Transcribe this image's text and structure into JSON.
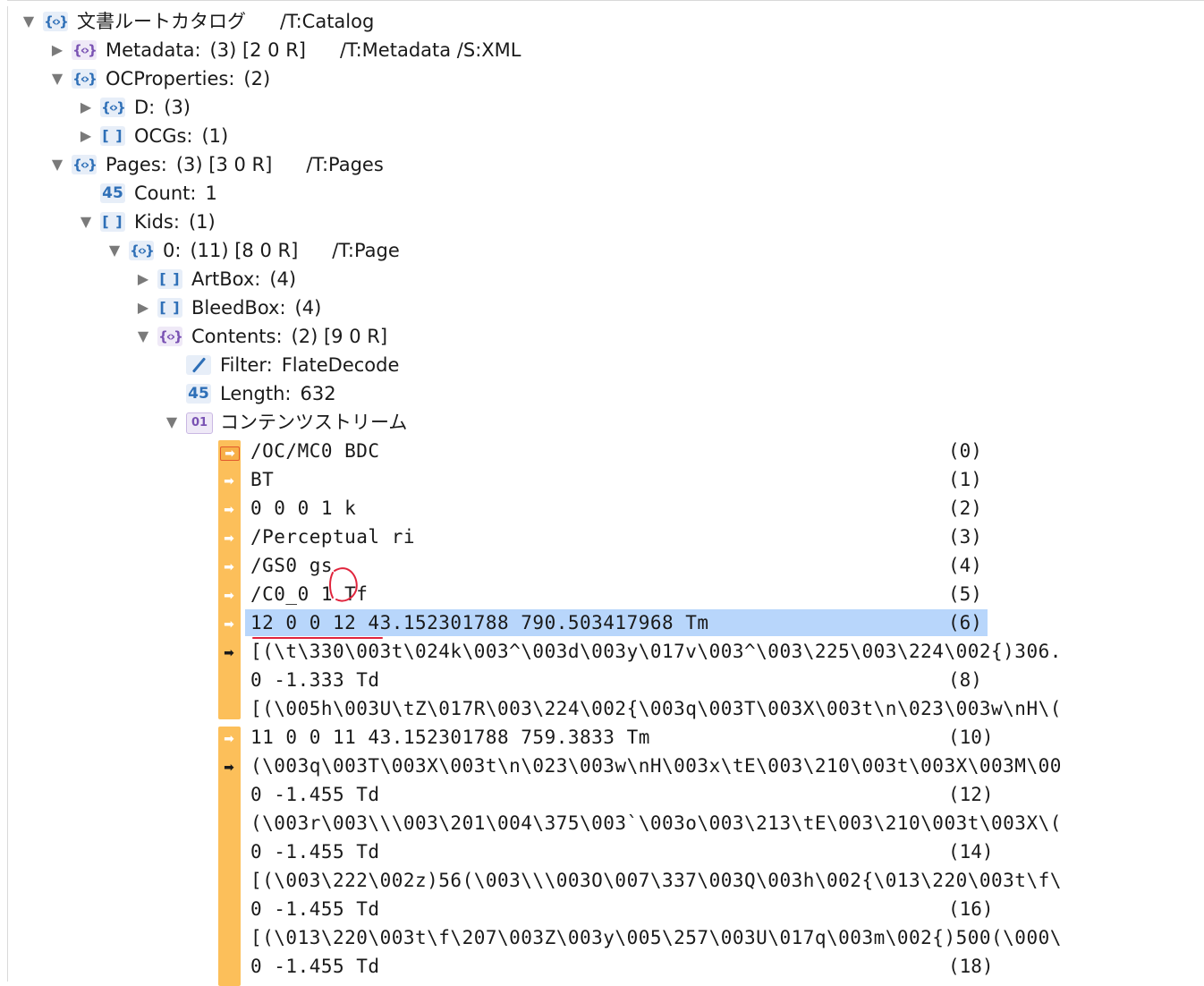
{
  "tree": [
    {
      "indent": 0,
      "toggle": "down",
      "icon": "dict",
      "label": "文書ルートカタログ",
      "info": "",
      "type": "/T:Catalog"
    },
    {
      "indent": 1,
      "toggle": "right",
      "icon": "dict-purple",
      "label": "Metadata:",
      "info": "(3) [2 0 R]",
      "type": "/T:Metadata  /S:XML"
    },
    {
      "indent": 1,
      "toggle": "down",
      "icon": "dict",
      "label": "OCProperties:",
      "info": "(2)",
      "type": ""
    },
    {
      "indent": 2,
      "toggle": "right",
      "icon": "dict",
      "label": "D:",
      "info": "(3)",
      "type": ""
    },
    {
      "indent": 2,
      "toggle": "right",
      "icon": "array",
      "label": "OCGs:",
      "info": "(1)",
      "type": ""
    },
    {
      "indent": 1,
      "toggle": "down",
      "icon": "dict",
      "label": "Pages:",
      "info": "(3) [3 0 R]",
      "type": "/T:Pages"
    },
    {
      "indent": 2,
      "toggle": "",
      "icon": "number",
      "label": "Count:",
      "info": "1",
      "type": ""
    },
    {
      "indent": 2,
      "toggle": "down",
      "icon": "array",
      "label": "Kids:",
      "info": "(1)",
      "type": ""
    },
    {
      "indent": 3,
      "toggle": "down",
      "icon": "dict",
      "label": "0:",
      "info": "(11) [8 0 R]",
      "type": "/T:Page"
    },
    {
      "indent": 4,
      "toggle": "right",
      "icon": "array",
      "label": "ArtBox:",
      "info": "(4)",
      "type": ""
    },
    {
      "indent": 4,
      "toggle": "right",
      "icon": "array",
      "label": "BleedBox:",
      "info": "(4)",
      "type": ""
    },
    {
      "indent": 4,
      "toggle": "down",
      "icon": "dict-purple",
      "label": "Contents:",
      "info": "(2) [9 0 R]",
      "type": ""
    },
    {
      "indent": 5,
      "toggle": "",
      "icon": "name",
      "label": "Filter:",
      "info": "FlateDecode",
      "type": ""
    },
    {
      "indent": 5,
      "toggle": "",
      "icon": "number",
      "label": "Length:",
      "info": "632",
      "type": ""
    },
    {
      "indent": 5,
      "toggle": "down",
      "icon": "stream",
      "label": "コンテンツストリーム",
      "info": "",
      "type": ""
    }
  ],
  "icons": {
    "dict": "{‹›}",
    "dict-purple": "{‹›}",
    "array": "[ ]",
    "number": "45",
    "name": "",
    "stream": "01"
  },
  "stream": [
    {
      "code": "/OC/MC0 BDC",
      "idx": "(0)",
      "selected": false
    },
    {
      "code": "BT",
      "idx": "(1)",
      "selected": false
    },
    {
      "code": "0 0 0 1 k",
      "idx": "(2)",
      "selected": false
    },
    {
      "code": "/Perceptual ri",
      "idx": "(3)",
      "selected": false
    },
    {
      "code": "/GS0 gs",
      "idx": "(4)",
      "selected": false
    },
    {
      "code": "/C0_0 1 Tf",
      "idx": "(5)",
      "selected": false
    },
    {
      "code": "12 0 0 12 43.152301788 790.503417968 Tm",
      "idx": "(6)",
      "selected": true
    },
    {
      "code": "[(\\t\\330\\003t\\024k\\003^\\003d\\003y\\017v\\003^\\003\\225\\003\\224\\002{)306.",
      "idx": "",
      "selected": false
    },
    {
      "code": "0 -1.333 Td",
      "idx": "(8)",
      "selected": false
    },
    {
      "code": "[(\\005h\\003U\\tZ\\017R\\003\\224\\002{\\003q\\003T\\003X\\003t\\n\\023\\003w\\nH\\(",
      "idx": "",
      "selected": false
    },
    {
      "code": "11 0 0 11 43.152301788 759.3833 Tm",
      "idx": "(10)",
      "selected": false
    },
    {
      "code": "(\\003q\\003T\\003X\\003t\\n\\023\\003w\\nH\\003x\\tE\\003\\210\\003t\\003X\\003M\\00",
      "idx": "",
      "selected": false
    },
    {
      "code": "0 -1.455 Td",
      "idx": "(12)",
      "selected": false
    },
    {
      "code": "(\\003r\\003\\\\\\003\\201\\004\\375\\003`\\003o\\003\\213\\tE\\003\\210\\003t\\003X\\(",
      "idx": "",
      "selected": false
    },
    {
      "code": "0 -1.455 Td",
      "idx": "(14)",
      "selected": false
    },
    {
      "code": "[(\\003\\222\\002z)56(\\003\\\\\\003O\\007\\337\\003Q\\003h\\002{\\013\\220\\003t\\f\\",
      "idx": "",
      "selected": false
    },
    {
      "code": "0 -1.455 Td",
      "idx": "(16)",
      "selected": false
    },
    {
      "code": "[(\\013\\220\\003t\\f\\207\\003Z\\003y\\005\\257\\003U\\017q\\003m\\002{)500(\\000\\",
      "idx": "",
      "selected": false
    },
    {
      "code": "0 -1.455 Td",
      "idx": "(18)",
      "selected": false
    }
  ]
}
